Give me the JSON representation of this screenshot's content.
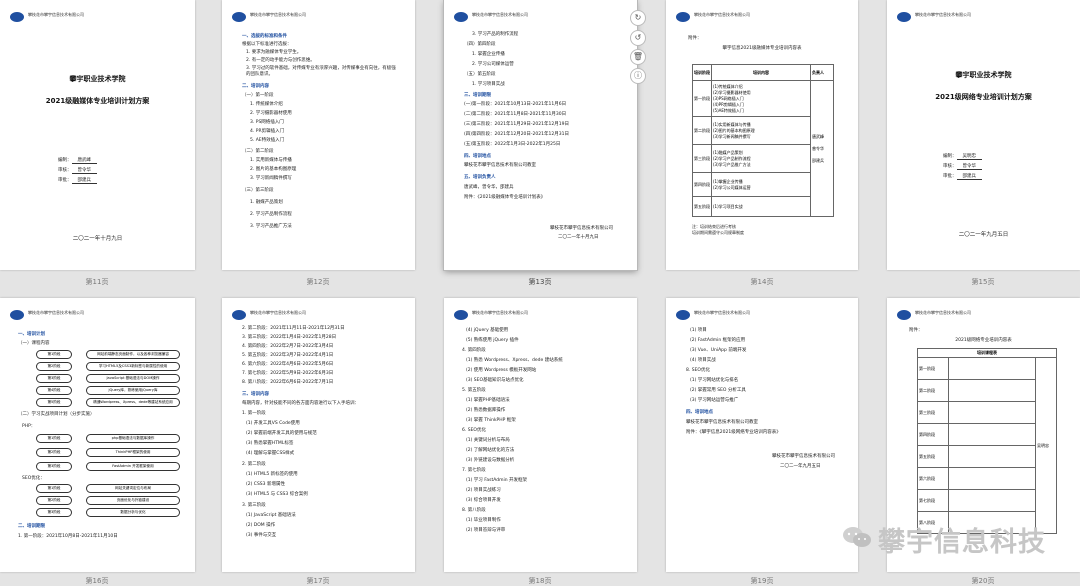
{
  "captions": [
    "第11页",
    "第12页",
    "第13页",
    "第14页",
    "第15页",
    "第16页",
    "第17页",
    "第18页",
    "第19页",
    "第20页"
  ],
  "company_header": "攀枝花市攀宇信息技术有限公司",
  "p11": {
    "school": "攀宇职业技术学院",
    "title": "2021级融媒体专业培训计划方案",
    "editor_label": "编制：",
    "editor": "唐武峰",
    "review_label": "审核：",
    "review": "曾令华",
    "approve_label": "审批：",
    "approve": "邵建兵",
    "date": "二〇二一年十月九日"
  },
  "p12": {
    "h1": "一、选拔的标准和条件",
    "lines": [
      "根据以下标准进行选拔：",
      "1. 要求为融媒体专业学生。",
      "2. 有一定的动手能力与创作思维。",
      "3. 学习过的软件基础，对传媒专业有浓厚兴趣，对传媒事业有向往，有极强的团队意识。"
    ],
    "h2": "二、培训内容",
    "sub1": "（一）第一阶段",
    "items1": [
      "1. 传统媒体介绍",
      "2. 学习摄影器材使用",
      "3. PS网络插入门",
      "4. PR剪辑插入门",
      "5. AE特效插入门"
    ],
    "sub2": "（二）第二阶段",
    "items2": [
      "1. 实用新媒体与传播",
      "2. 图片的基本构图原理",
      "3. 学习新闻稿件撰写"
    ],
    "sub3": "（三）第三阶段",
    "items3": [
      "1. 融媒产品策划",
      "2. 学习产品制作流程",
      "3. 学习产品推广方法"
    ]
  },
  "p13": {
    "lines": [
      "3. 学习产品的制作流程",
      "（四）第四阶段",
      "1. 掌握企业传播",
      "2. 学习公司媒体运营"
    ],
    "sub5": "（五）第五阶段",
    "items5": [
      "1. 学习项目实战"
    ],
    "h3": "三、培训期限",
    "phases": [
      "(一)第一阶段：2021年10月13日-2021年11月6日",
      "(二)第二阶段：2021年11月8日-2021年11月30日",
      "(三)第三阶段：2021年11月29日-2021年12月19日",
      "(四)第四阶段：2021年12月20日-2021年12月31日",
      "(五)第五阶段：2022年1月3日-2022年1月25日"
    ],
    "h4": "四、培训地点",
    "place": "攀枝花市攀宇信息技术有限公司教室",
    "h5": "五、培训负责人",
    "people": "唐武峰，曾令华，邵建兵",
    "attach": "附件：《2021级融媒体专业培训计划表》",
    "footer_company": "攀枝花市攀宇信息技术有限公司",
    "footer_date": "二〇二一年十月九日"
  },
  "p14": {
    "attach": "附件：",
    "title": "攀宇信息2021级融媒体专业培训内容表",
    "cols": [
      "培训阶段",
      "培训内容",
      "负责人"
    ],
    "rows": [
      {
        "stage": "第一阶段",
        "content": [
          "(1)传统媒体介绍",
          "(2)学习摄影器材使用",
          "(3)PS网络插入门",
          "(4)PR剪辑插入门",
          "(5)AE特效插入门"
        ]
      },
      {
        "stage": "第二阶段",
        "content": [
          "(1)实用新媒体与传播",
          "(2)图片的基本构图原理",
          "(3)学习新闻稿件撰写"
        ]
      },
      {
        "stage": "第三阶段",
        "content": [
          "(1)融媒产品策划",
          "(2)学习产品制作流程",
          "(3)学习产品推广方法"
        ]
      },
      {
        "stage": "第四阶段",
        "content": [
          "(1)掌握企业传播",
          "(2)学习公司媒体运营"
        ]
      },
      {
        "stage": "第五阶段",
        "content": [
          "(1)学习项目实战"
        ]
      }
    ],
    "owners": [
      "唐武峰",
      "曾令华",
      "邵建兵"
    ],
    "notes": [
      "注：培训结束后进行考核",
      "培训期间需遵守公司规章制度"
    ]
  },
  "p15": {
    "school": "攀宇职业技术学院",
    "title": "2021级网络专业培训计划方案",
    "editor_label": "编制：",
    "editor": "吴明忠",
    "review_label": "审核：",
    "review": "曾令华",
    "approve_label": "审批：",
    "approve": "邵建兵",
    "date": "二〇二一年九月五日"
  },
  "p16": {
    "h1": "一、培训计划",
    "sub1": "（一）课程内容",
    "flow1": [
      {
        "stage": "第1阶段",
        "item": "网站前端静态页面制作，以及各种浏览器兼容"
      },
      {
        "stage": "第2阶段",
        "item": "学习HTML5及CSS3新标签与新属性的使用"
      },
      {
        "stage": "第3阶段",
        "item": "JavaScript 基础语法与DOM操作"
      },
      {
        "stage": "第4阶段",
        "item": "jQuery库，熟练使用jQuery库"
      },
      {
        "stage": "第5阶段",
        "item": "精通Wordpress、Xpress、dede等建站系统应用"
      }
    ],
    "sub2": "（二）学习实战项目计划（分步实施）",
    "php": "PHP：",
    "flow2": [
      {
        "stage": "第1阶段",
        "item": "php基础语法与数据库操作"
      },
      {
        "stage": "第2阶段",
        "item": "ThinkPHP框架的使用"
      },
      {
        "stage": "第3阶段",
        "item": "FastAdmin 开发框架使用"
      }
    ],
    "seo": "SEO优化：",
    "flow3": [
      {
        "stage": "第1阶段",
        "item": "网站关键词定位与布局"
      },
      {
        "stage": "第2阶段",
        "item": "页面优化与外链建设"
      },
      {
        "stage": "第3阶段",
        "item": "数据分析与优化"
      }
    ],
    "h2": "二、培训期限",
    "phase1": "1. 第一阶段：2021年10月8日-2021年11月10日"
  },
  "p17": {
    "phases": [
      "2. 第二阶段：2021年11月11日-2021年12月31日",
      "3. 第三阶段：2022年1月4日-2022年1月28日",
      "4. 第四阶段：2022年2月7日-2022年3月4日",
      "5. 第五阶段：2022年3月7日-2022年4月1日",
      "6. 第六阶段：2022年4月6日-2022年5月6日",
      "7. 第七阶段：2022年5月9日-2022年6月3日",
      "8. 第八阶段：2022年6月6日-2022年7月1日"
    ],
    "h3": "三、培训内容",
    "intro": "每期内容，针对技能不同的各方面内容进行以下入手培训：",
    "sub1": "1. 第一阶段",
    "items1": [
      "(1) 开发工具VS Code使用",
      "(2) 掌握前端开发工具的使用与规范",
      "(3) 熟悉掌握HTML标签",
      "(4) 理解与掌握CSS样式"
    ],
    "sub2": "2. 第二阶段",
    "items2": [
      "(1) HTML5 新标签的使用",
      "(2) CSS3 新增属性",
      "(3) HTML5 与 CSS3 综合案例"
    ],
    "sub3": "3. 第三阶段",
    "items3": [
      "(1) JavaScript 基础语法",
      "(2) DOM 操作",
      "(3) 事件与交互"
    ]
  },
  "p18": {
    "lines": [
      "(4) jQuery 基础使用",
      "(5) 熟练使用 jQuery 插件",
      "4. 第四阶段",
      "(1) 熟悉 Wordpress、Xpress、dede 建站系统",
      "(2) 使用 Wordpress 模板开发网站",
      "(3) SEO基础知识与站点优化",
      "5. 第五阶段",
      "(1) 掌握PHP基础语法",
      "(2) 熟悉数据库操作",
      "(3) 掌握 ThinkPHP 框架",
      "6. SEO优化",
      "(1) 关键词分析与布局",
      "(2) 了解网站优化的方法",
      "(3) 外链建设与数据分析",
      "7. 第七阶段",
      "(1) 学习 FastAdmin 开发框架",
      "(2) 项目实战练习",
      "(3) 综合项目开发",
      "8. 第八阶段",
      "(1) 毕业项目制作",
      "(2) 项目答辩与评审"
    ]
  },
  "p19": {
    "lines": [
      "(1) 项目",
      "(2) FastAdmin 框架的应用",
      "(3) Vue、UniApp 前端开发",
      "(4) 项目实战",
      "8. SEO优化",
      "(1) 学习网站优化与排名",
      "(2) 掌握常用 SEO 分析工具",
      "(3) 学习网站运营与推广"
    ],
    "h4": "四、培训地点",
    "place": "攀枝花市攀宇信息技术有限公司教室",
    "attach": "附件：《攀宇信息2021级网络专业培训内容表》",
    "footer_company": "攀枝花市攀宇信息技术有限公司",
    "footer_date": "二〇二一年九月五日"
  },
  "p20": {
    "attach": "附件：",
    "title": "2021级网络专业培训内容表",
    "header": "培训课程表",
    "stages": [
      "第一阶段",
      "第二阶段",
      "第三阶段",
      "第四阶段",
      "第五阶段",
      "第六阶段",
      "第七阶段",
      "第八阶段"
    ],
    "owner": "吴明忠"
  },
  "watermark": "攀宇信息科技"
}
